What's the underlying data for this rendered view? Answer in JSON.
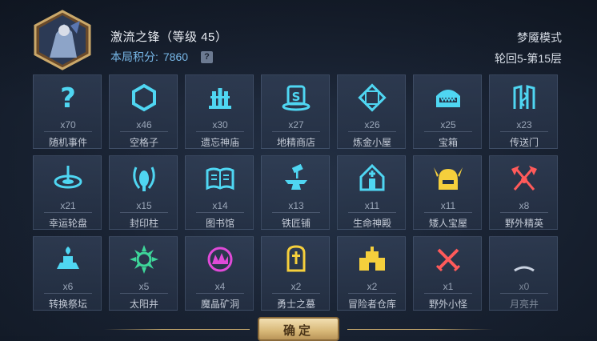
{
  "player": {
    "name": "激流之锋（等级 45）",
    "score_label": "本局积分:",
    "score_value": "7860",
    "help_icon": "?"
  },
  "mode": {
    "name": "梦魇模式",
    "progress": "轮回5-第15层"
  },
  "tiles": [
    {
      "count": "x70",
      "label": "随机事件",
      "icon": "question-mark-icon",
      "color": "#4fd6f2"
    },
    {
      "count": "x46",
      "label": "空格子",
      "icon": "hexagon-icon",
      "color": "#4fd6f2"
    },
    {
      "count": "x30",
      "label": "遗忘神庙",
      "icon": "temple-icon",
      "color": "#4fd6f2"
    },
    {
      "count": "x27",
      "label": "地精商店",
      "icon": "shop-s-icon",
      "color": "#4fd6f2"
    },
    {
      "count": "x26",
      "label": "炼金小屋",
      "icon": "alchemy-diamond-icon",
      "color": "#4fd6f2"
    },
    {
      "count": "x25",
      "label": "宝箱",
      "icon": "treasure-chest-icon",
      "color": "#4fd6f2"
    },
    {
      "count": "x23",
      "label": "传送门",
      "icon": "portal-icon",
      "color": "#4fd6f2"
    },
    {
      "count": "x21",
      "label": "幸运轮盘",
      "icon": "roulette-icon",
      "color": "#4fd6f2"
    },
    {
      "count": "x15",
      "label": "封印柱",
      "icon": "seal-pillar-icon",
      "color": "#4fd6f2"
    },
    {
      "count": "x14",
      "label": "图书馆",
      "icon": "book-icon",
      "color": "#4fd6f2"
    },
    {
      "count": "x13",
      "label": "铁匠铺",
      "icon": "anvil-icon",
      "color": "#4fd6f2"
    },
    {
      "count": "x11",
      "label": "生命神殿",
      "icon": "life-shrine-icon",
      "color": "#4fd6f2"
    },
    {
      "count": "x11",
      "label": "矮人宝屋",
      "icon": "dwarf-helmet-icon",
      "color": "#f5cf3c"
    },
    {
      "count": "x8",
      "label": "野外精英",
      "icon": "crossed-axes-icon",
      "color": "#ff5a5a"
    },
    {
      "count": "x6",
      "label": "转换祭坛",
      "icon": "altar-icon",
      "color": "#4fd6f2"
    },
    {
      "count": "x5",
      "label": "太阳井",
      "icon": "sun-well-icon",
      "color": "#3ed69a"
    },
    {
      "count": "x4",
      "label": "魔晶矿洞",
      "icon": "crystal-mine-icon",
      "color": "#e04ad8"
    },
    {
      "count": "x2",
      "label": "勇士之墓",
      "icon": "tombstone-icon",
      "color": "#f5cf3c"
    },
    {
      "count": "x2",
      "label": "冒险者仓库",
      "icon": "warehouse-icon",
      "color": "#f5cf3c"
    },
    {
      "count": "x1",
      "label": "野外小怪",
      "icon": "crossed-swords-icon",
      "color": "#ff5a5a"
    },
    {
      "count": "x0",
      "label": "月亮井",
      "icon": "moon-well-icon",
      "color": "#c9d2e0"
    }
  ],
  "confirm_label": "确定"
}
